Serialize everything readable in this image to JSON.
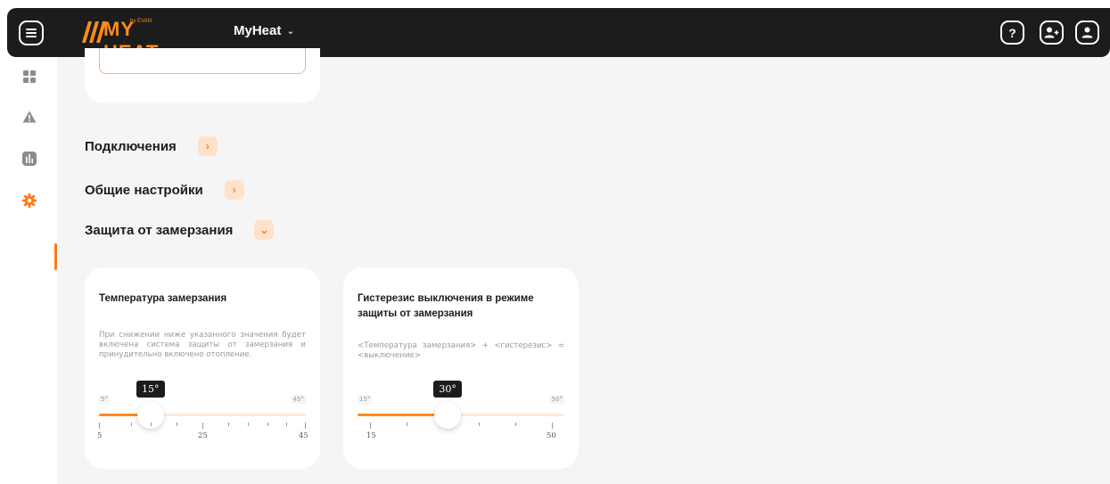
{
  "header": {
    "logo_text": "MY HEAT",
    "logo_sub": "by EVAN",
    "device_name": "MyHeat",
    "device_chevron": "⌄",
    "help_icon": "?",
    "add_user_icon": "add-user-icon",
    "profile_icon": "user-icon"
  },
  "sidebar": {
    "items": [
      {
        "name": "dashboard",
        "icon": "dashboard-icon"
      },
      {
        "name": "alerts",
        "icon": "warning-icon"
      },
      {
        "name": "statistics",
        "icon": "chart-icon"
      },
      {
        "name": "settings",
        "icon": "gear-icon",
        "active": true
      }
    ]
  },
  "sections": [
    {
      "label": "Подключения",
      "toggle": "›",
      "expanded": false
    },
    {
      "label": "Общие настройки",
      "toggle": "›",
      "expanded": false
    },
    {
      "label": "Защита от замерзания",
      "toggle": "⌄",
      "expanded": true
    }
  ],
  "cards": [
    {
      "title": "Температура замерзания",
      "description": "При снижении ниже указанного значения будет включена система защиты от замерзания и принудительно включено отопление.",
      "min_label": "5°",
      "max_label": "45°",
      "value_label": "15°",
      "value": 15,
      "min": 5,
      "max": 45,
      "tick_labels": [
        "5",
        "25",
        "45"
      ]
    },
    {
      "title": "Гистерезис выключения в режиме защиты от замерзания",
      "description": "<Температура замерзания> + <гистерезис> = <выключение>",
      "min_label": "15°",
      "max_label": "50°",
      "value_label": "30°",
      "value": 30,
      "min": 15,
      "max": 50,
      "tick_labels": [
        "15",
        "50"
      ]
    }
  ],
  "colors": {
    "accent": "#ff7a1a",
    "accent_light": "#ffe2cc",
    "topbar": "#1c1c1c",
    "background": "#f5f5f5"
  }
}
